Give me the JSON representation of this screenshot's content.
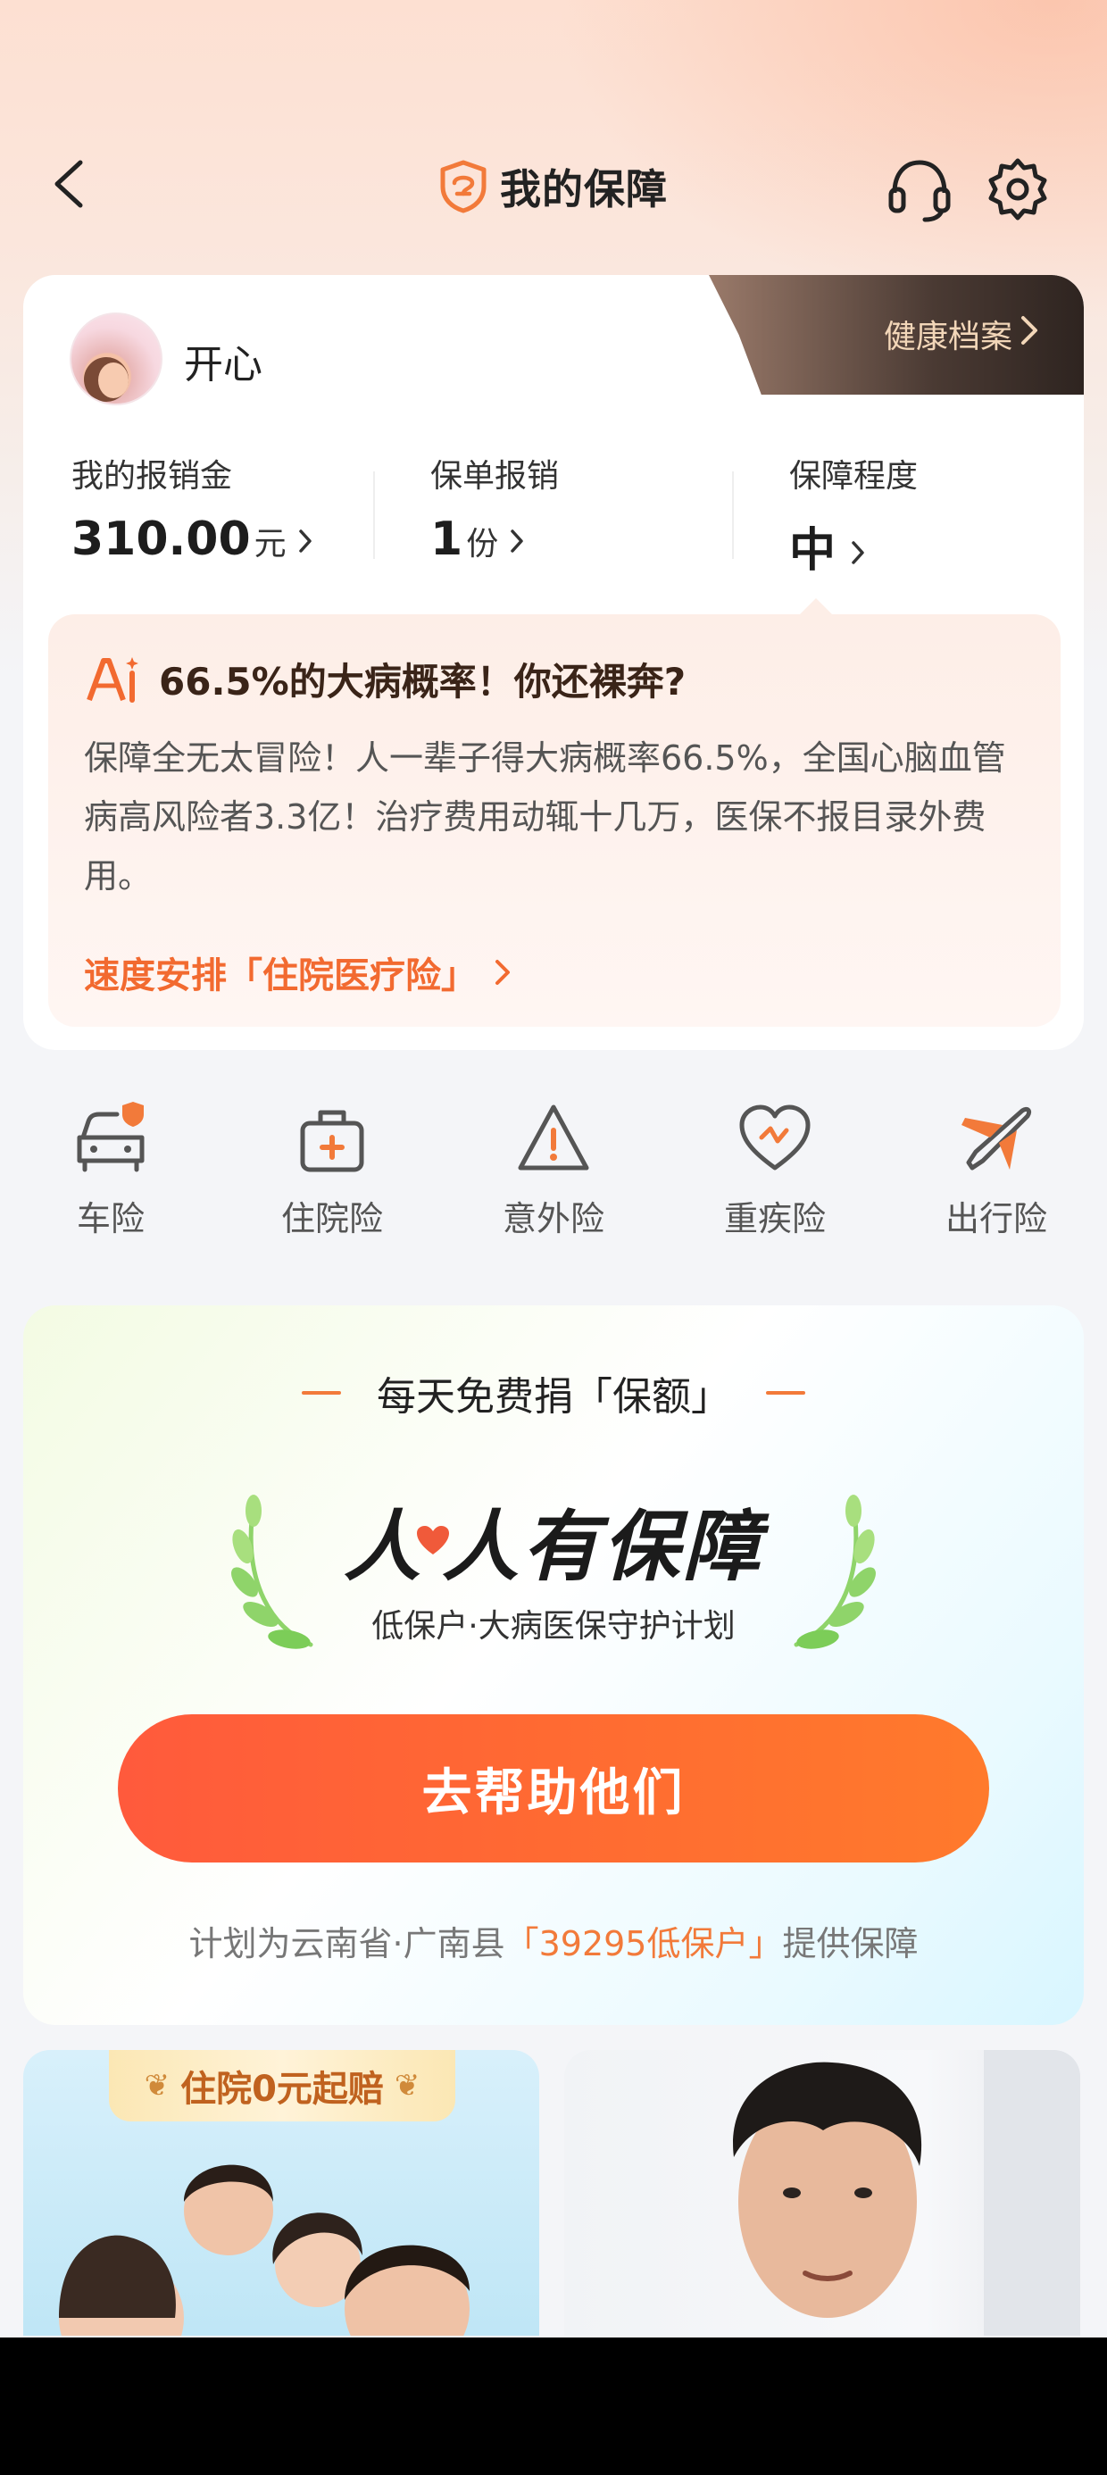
{
  "nav": {
    "title": "我的保障"
  },
  "profile": {
    "username": "开心",
    "health_tab": "健康档案"
  },
  "stats": [
    {
      "label": "我的报销金",
      "value": "310.00",
      "unit": "元"
    },
    {
      "label": "保单报销",
      "value": "1",
      "unit": "份"
    },
    {
      "label": "保障程度",
      "value": "中",
      "unit": ""
    }
  ],
  "ai_tip": {
    "title": "66.5%的大病概率！你还裸奔?",
    "body": "保障全无太冒险！人一辈子得大病概率66.5%，全国心脑血管病高风险者3.3亿！治疗费用动辄十几万，医保不报目录外费用。",
    "link": "速度安排「住院医疗险」"
  },
  "quick_items": [
    {
      "label": "车险",
      "icon": "car-icon"
    },
    {
      "label": "住院险",
      "icon": "medical-kit-icon"
    },
    {
      "label": "意外险",
      "icon": "warning-icon"
    },
    {
      "label": "重疾险",
      "icon": "heart-pulse-icon"
    },
    {
      "label": "出行险",
      "icon": "plane-icon"
    }
  ],
  "donate": {
    "heading": "每天免费捐「保额」",
    "brand_part1": "人",
    "brand_part2": "人有保障",
    "subtitle": "低保户·大病医保守护计划",
    "button": "去帮助他们",
    "footer_pre": "计划为云南省·广南县",
    "footer_highlight": "「39295低保户」",
    "footer_post": "提供保障"
  },
  "promo": {
    "badge": "住院0元起赔"
  },
  "colors": {
    "accent": "#f26a30",
    "button_start": "#ff5a3c",
    "button_end": "#ff7a2c"
  }
}
